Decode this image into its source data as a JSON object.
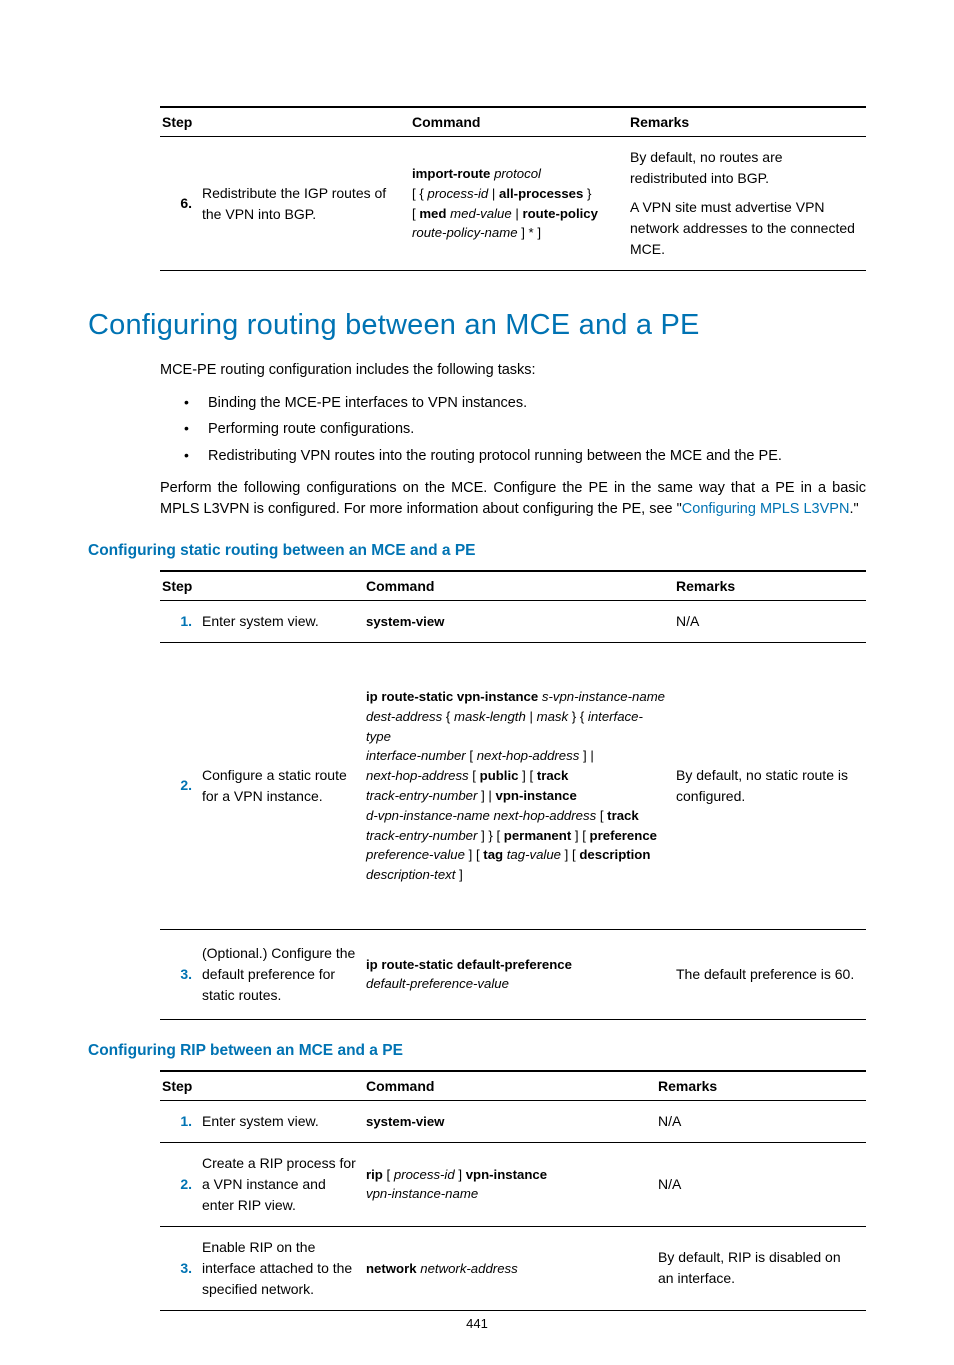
{
  "topTable": {
    "headers": {
      "step": "Step",
      "command": "Command",
      "remarks": "Remarks"
    },
    "row6": {
      "num": "6.",
      "step": "Redistribute the IGP routes of the VPN into BGP.",
      "remarks_a": "By default, no routes are redistributed into BGP.",
      "remarks_b": "A VPN site must advertise VPN network addresses to the connected MCE."
    }
  },
  "h1": "Configuring routing between an MCE and a PE",
  "intro": "MCE-PE routing configuration includes the following tasks:",
  "bullets": {
    "b1": "Binding the MCE-PE interfaces to VPN instances.",
    "b2": "Performing route configurations.",
    "b3": "Redistributing VPN routes into the routing protocol running between the MCE and the PE."
  },
  "para2_a": "Perform the following configurations on the MCE. Configure the PE in the same way that a PE in a basic MPLS L3VPN is configured. For more information about configuring the PE, see \"",
  "para2_link": "Configuring MPLS L3VPN",
  "para2_b": ".\"",
  "h2a": "Configuring static routing between an MCE and a PE",
  "staticTable": {
    "headers": {
      "step": "Step",
      "command": "Command",
      "remarks": "Remarks"
    },
    "r1": {
      "num": "1.",
      "step": "Enter system view.",
      "cmd": "system-view",
      "remarks": "N/A"
    },
    "r2": {
      "num": "2.",
      "step": "Configure a static route for a VPN instance.",
      "remarks": "By default, no static route is configured."
    },
    "r3": {
      "num": "3.",
      "step": "(Optional.) Configure the default preference for static routes.",
      "remarks": "The default preference is 60."
    }
  },
  "h2b": "Configuring RIP between an MCE and a PE",
  "ripTable": {
    "headers": {
      "step": "Step",
      "command": "Command",
      "remarks": "Remarks"
    },
    "r1": {
      "num": "1.",
      "step": "Enter system view.",
      "cmd": "system-view",
      "remarks": "N/A"
    },
    "r2": {
      "num": "2.",
      "step": "Create a RIP process for a VPN instance and enter RIP view.",
      "remarks": "N/A"
    },
    "r3": {
      "num": "3.",
      "step": "Enable RIP on the interface attached to the specified network.",
      "remarks": "By default, RIP is disabled on an interface."
    }
  },
  "pageNum": "441"
}
